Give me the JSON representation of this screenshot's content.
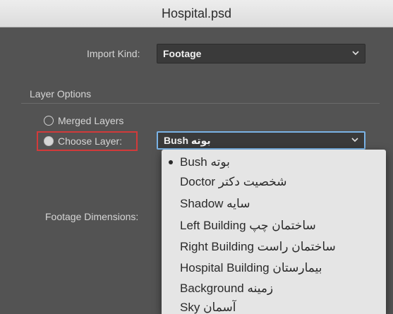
{
  "window": {
    "title": "Hospital.psd"
  },
  "import_kind": {
    "label": "Import Kind:",
    "value": "Footage"
  },
  "layer_options": {
    "heading": "Layer Options",
    "merged_layers_label": "Merged Layers",
    "choose_layer_label": "Choose Layer:",
    "selected_option": "choose_layer",
    "layer_value": "بوته Bush"
  },
  "footage_dimensions": {
    "label": "Footage Dimensions:"
  },
  "layer_menu": {
    "items": [
      {
        "label": "Bush بوته",
        "checked": true
      },
      {
        "label": "شخصیت دکتر Doctor",
        "checked": false
      },
      {
        "label": "Shadow سایه",
        "checked": false
      },
      {
        "label": "ساختمان چپ Left Building",
        "checked": false
      },
      {
        "label": "ساختمان راست Right Building",
        "checked": false
      },
      {
        "label": "بیمارستان Hospital Building",
        "checked": false
      },
      {
        "label": "Background زمینه",
        "checked": false
      },
      {
        "label": "Sky آسمان",
        "checked": false
      }
    ]
  },
  "colors": {
    "panel": "#535353",
    "focus_ring": "#7ab3e6",
    "annotation_box": "#d23a3a",
    "menu_background": "#e5e5e5"
  }
}
